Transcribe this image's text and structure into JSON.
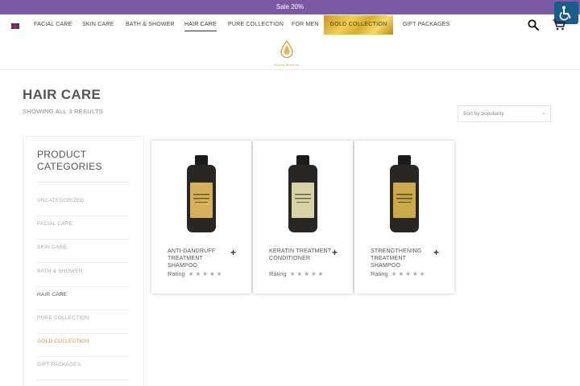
{
  "topbar": {
    "promo": "Sale 20%"
  },
  "nav": {
    "items": [
      "FACIAL CARE",
      "SKIN CARE",
      "BATH & SHOWER",
      "HAIR CARE",
      "PURE COLLECTION",
      "FOR MEN",
      "GOLD COLLECTION",
      "GIFT PACKAGES"
    ],
    "active": "HAIR CARE"
  },
  "logo": {
    "name": "Swiss Mineral"
  },
  "page": {
    "title": "HAIR CARE",
    "results": "SHOWING ALL 3 RESULTS"
  },
  "sort": {
    "selected": "Sort by popularity"
  },
  "sidebar": {
    "title": "PRODUCT CATEGORIES",
    "items": [
      "UNCATEGORIZED",
      "FACIAL CARE",
      "SKIN CARE",
      "BATH & SHOWER",
      "HAIR CARE",
      "PURE COLLECTION",
      "GOLD COLLECTION",
      "GIFT PACKAGES"
    ],
    "current": "HAIR CARE"
  },
  "products": [
    {
      "name": "ANTI-DANDRUFF TREATMENT SHAMPOO",
      "rating_label": "Rating",
      "stars": "★★★★★",
      "label_color": "#d4b15a"
    },
    {
      "name": "KERATIN TREATMENT CONDITIONER",
      "rating_label": "Rating",
      "stars": "★★★★★",
      "label_color": "#d9d2a8"
    },
    {
      "name": "STRENGTHENING TREATMENT SHAMPOO",
      "rating_label": "Rating",
      "stars": "★★★★★",
      "label_color": "#c9a94a"
    }
  ],
  "colors": {
    "accent": "#7b5aa3",
    "gold": "#c99d3a",
    "accessibility": "#1b5c8a"
  }
}
